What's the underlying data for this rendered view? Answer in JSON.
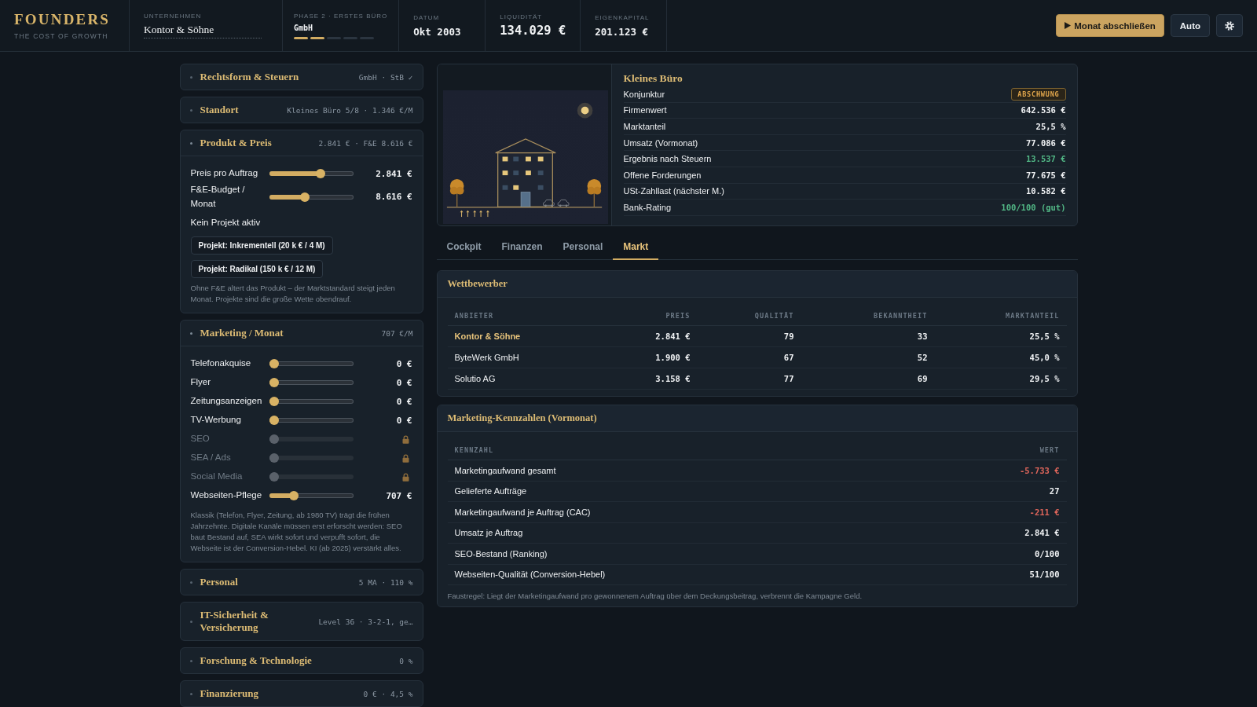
{
  "header": {
    "logo": {
      "title": "FOUNDERS",
      "subtitle": "THE COST OF GROWTH"
    },
    "company": {
      "label": "UNTERNEHMEN",
      "value": "Kontor & Söhne"
    },
    "phase": {
      "label": "PHASE 2 · ERSTES BÜRO",
      "value": "GmbH",
      "steps": [
        {
          "done": true
        },
        {
          "done": true
        },
        {
          "done": false
        },
        {
          "done": false
        },
        {
          "done": false
        }
      ]
    },
    "stats": [
      {
        "label": "DATUM",
        "value": "Okt 2003",
        "kind": "normal"
      },
      {
        "label": "LIQUIDITÄT",
        "value": "134.029 €",
        "kind": "large"
      },
      {
        "label": "EIGENKAPITAL",
        "value": "201.123 €",
        "kind": "normal"
      }
    ],
    "actions": [
      {
        "kind": "primary",
        "label": "Monat abschließen"
      },
      {
        "kind": "secondary",
        "label": "Auto"
      },
      {
        "kind": "settings"
      }
    ]
  },
  "sections": [
    {
      "title": "Rechtsform & Steuern",
      "summary": "GmbH · StB ✓",
      "expanded": false
    },
    {
      "title": "Standort",
      "summary": "Kleines Büro 5/8 · 1.346 €/M",
      "expanded": false
    },
    {
      "title": "Produkt & Preis",
      "summary": "2.841 € · F&E 8.616 €",
      "expanded": true,
      "sliders": [
        {
          "label": "Preis pro Auftrag",
          "level": 0.63,
          "value": "2.841 €",
          "locked": false
        },
        {
          "label": "F&E-Budget / Monat",
          "level": 0.42,
          "value": "8.616 €",
          "locked": false
        }
      ],
      "status": "Kein Projekt aktiv",
      "buttons": [
        "Projekt: Inkrementell (20 k € / 4 M)",
        "Projekt: Radikal (150 k € / 12 M)"
      ],
      "note": "Ohne F&E altert das Produkt – der Marktstandard steigt jeden Monat. Projekte sind die große Wette obendrauf."
    },
    {
      "title": "Marketing / Monat",
      "summary": "707 €/M",
      "expanded": true,
      "sliders": [
        {
          "label": "Telefonakquise",
          "level": 0,
          "value": "0 €",
          "locked": false
        },
        {
          "label": "Flyer",
          "level": 0,
          "value": "0 €",
          "locked": false
        },
        {
          "label": "Zeitungsanzeigen",
          "level": 0,
          "value": "0 €",
          "locked": false
        },
        {
          "label": "TV-Werbung",
          "level": 0,
          "value": "0 €",
          "locked": false
        },
        {
          "label": "SEO",
          "level": 0,
          "locked": true
        },
        {
          "label": "SEA / Ads",
          "level": 0,
          "locked": true
        },
        {
          "label": "Social Media",
          "level": 0,
          "locked": true
        },
        {
          "label": "Webseiten-Pflege",
          "level": 0.27,
          "value": "707 €",
          "locked": false
        }
      ],
      "note": "Klassik (Telefon, Flyer, Zeitung, ab 1980 TV) trägt die frühen Jahrzehnte. Digitale Kanäle müssen erst erforscht werden: SEO baut Bestand auf, SEA wirkt sofort und verpufft sofort, die Webseite ist der Conversion-Hebel. KI (ab 2025) verstärkt alles."
    },
    {
      "title": "Personal",
      "summary": "5 MA · 110 %",
      "expanded": false
    },
    {
      "title": "IT-Sicherheit & Versicherung",
      "summary": "Level 36 · 3-2-1, ge…",
      "expanded": false
    },
    {
      "title": "Forschung & Technologie",
      "summary": "0 %",
      "expanded": false
    },
    {
      "title": "Finanzierung",
      "summary": "0 € · 4,5 %",
      "expanded": false
    }
  ],
  "office": {
    "title": "Kleines Büro",
    "rows": [
      {
        "label": "Konjunktur",
        "value": "ABSCHWUNG",
        "kind": "badge"
      },
      {
        "label": "Firmenwert",
        "value": "642.536 €",
        "kind": "value",
        "positive": false
      },
      {
        "label": "Marktanteil",
        "value": "25,5 %",
        "kind": "value",
        "positive": false
      },
      {
        "label": "Umsatz (Vormonat)",
        "value": "77.086 €",
        "kind": "value",
        "positive": false
      },
      {
        "label": "Ergebnis nach Steuern",
        "value": "13.537 €",
        "kind": "value",
        "positive": true
      },
      {
        "label": "Offene Forderungen",
        "value": "77.675 €",
        "kind": "value",
        "positive": false
      },
      {
        "label": "USt-Zahllast (nächster M.)",
        "value": "10.582 €",
        "kind": "value",
        "positive": false
      },
      {
        "label": "Bank-Rating",
        "value": "100/100 (gut)",
        "kind": "value",
        "positive": true
      }
    ]
  },
  "tabs": [
    {
      "label": "Cockpit",
      "selected": false
    },
    {
      "label": "Finanzen",
      "selected": false
    },
    {
      "label": "Personal",
      "selected": false
    },
    {
      "label": "Markt",
      "selected": true
    }
  ],
  "competitors": {
    "title": "Wettbewerber",
    "columns": [
      "ANBIETER",
      "PREIS",
      "QUALITÄT",
      "BEKANNTHEIT",
      "MARKTANTEIL"
    ],
    "rows": [
      {
        "highlighted": true,
        "cells": [
          "Kontor & Söhne",
          "2.841 €",
          "79",
          "33",
          "25,5 %"
        ]
      },
      {
        "highlighted": false,
        "cells": [
          "ByteWerk GmbH",
          "1.900 €",
          "67",
          "52",
          "45,0 %"
        ]
      },
      {
        "highlighted": false,
        "cells": [
          "Solutio AG",
          "3.158 €",
          "77",
          "69",
          "29,5 %"
        ]
      }
    ]
  },
  "marketing_kpis": {
    "title": "Marketing-Kennzahlen (Vormonat)",
    "columns": [
      "KENNZAHL",
      "WERT"
    ],
    "rows": [
      {
        "label": "Marketingaufwand gesamt",
        "value": "-5.733 €",
        "negative": true
      },
      {
        "label": "Gelieferte Aufträge",
        "value": "27",
        "negative": false
      },
      {
        "label": "Marketingaufwand je Auftrag (CAC)",
        "value": "-211 €",
        "negative": true
      },
      {
        "label": "Umsatz je Auftrag",
        "value": "2.841 €",
        "negative": false
      },
      {
        "label": "SEO-Bestand (Ranking)",
        "value": "0/100",
        "negative": false
      },
      {
        "label": "Webseiten-Qualität (Conversion-Hebel)",
        "value": "51/100",
        "negative": false
      }
    ],
    "note": "Faustregel: Liegt der Marketingaufwand pro gewonnenem Auftrag über dem Deckungsbeitrag, verbrennt die Kampagne Geld."
  }
}
